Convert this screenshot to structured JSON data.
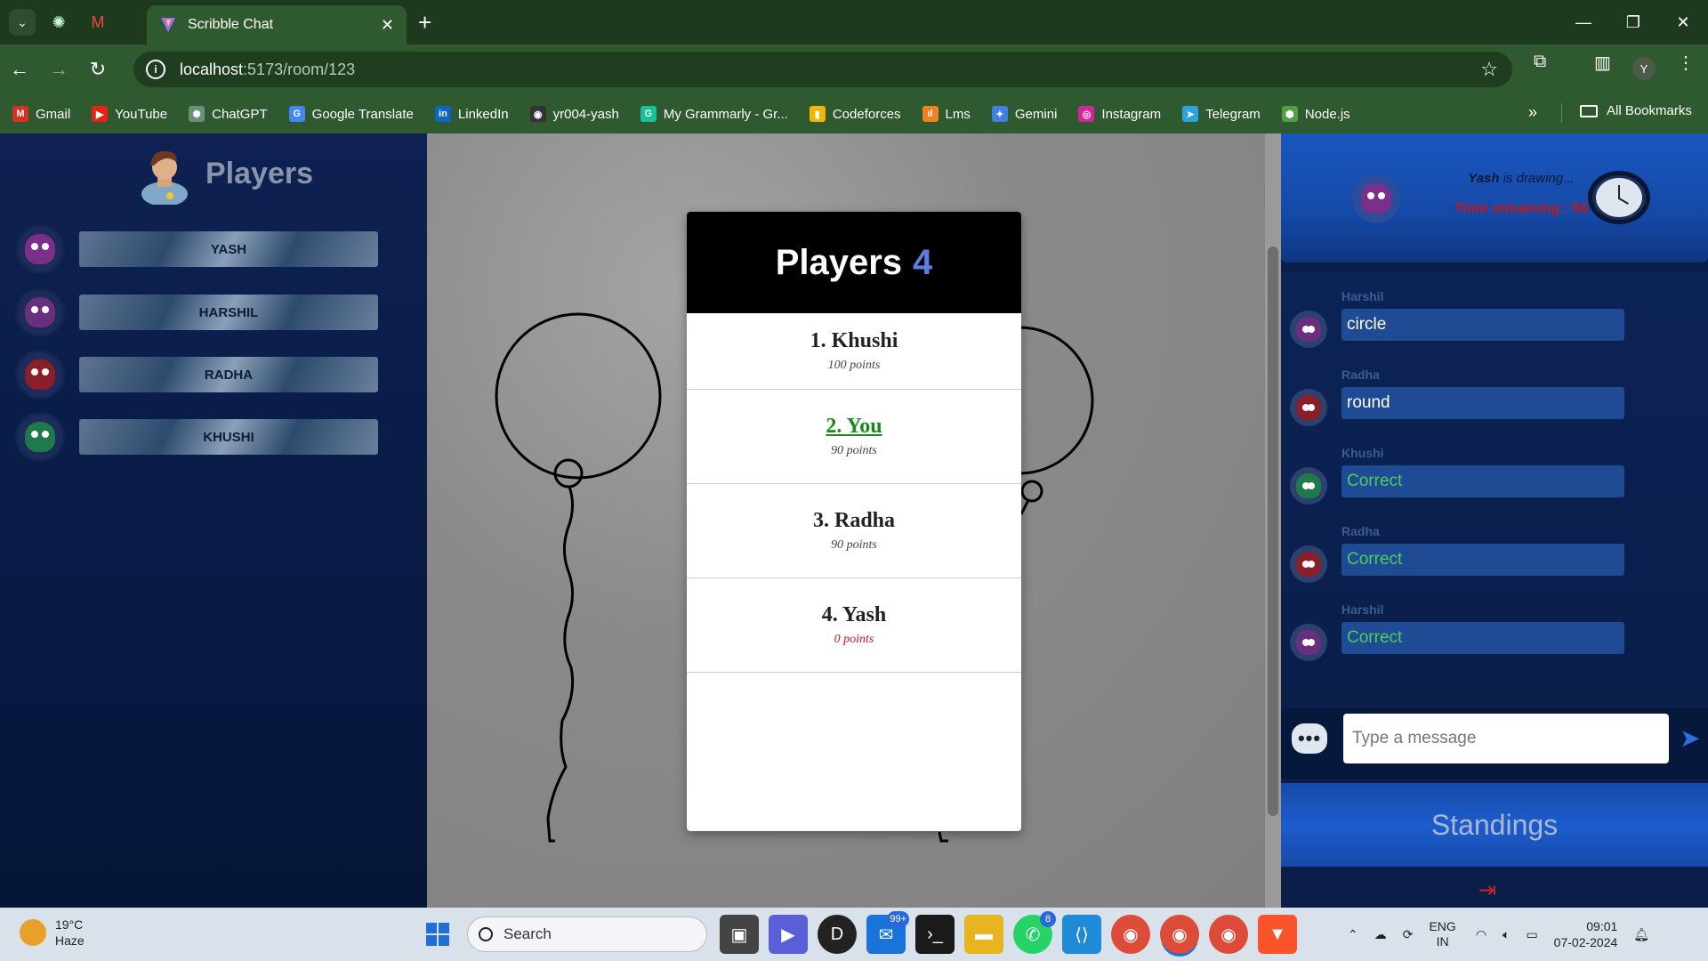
{
  "browser": {
    "tab_title": "Scribble Chat",
    "url_host": "localhost",
    "url_path": ":5173/room/123",
    "profile_initial": "Y",
    "bookmarks": [
      {
        "label": "Gmail",
        "color": "#d93025",
        "glyph": "M"
      },
      {
        "label": "YouTube",
        "color": "#e62117",
        "glyph": "▶"
      },
      {
        "label": "ChatGPT",
        "color": "#6b8f7b",
        "glyph": "✺"
      },
      {
        "label": "Google Translate",
        "color": "#4285f4",
        "glyph": "G"
      },
      {
        "label": "LinkedIn",
        "color": "#0a66c2",
        "glyph": "in"
      },
      {
        "label": "yr004-yash",
        "color": "#333",
        "glyph": "◉"
      },
      {
        "label": "My Grammarly - Gr...",
        "color": "#15c39a",
        "glyph": "G"
      },
      {
        "label": "Codeforces",
        "color": "#f4b400",
        "glyph": "▮"
      },
      {
        "label": "Lms",
        "color": "#f08020",
        "glyph": "ıl"
      },
      {
        "label": "Gemini",
        "color": "#3e7fe8",
        "glyph": "✦"
      },
      {
        "label": "Instagram",
        "color": "#d6249f",
        "glyph": "◎"
      },
      {
        "label": "Telegram",
        "color": "#2aa3e0",
        "glyph": "➤"
      },
      {
        "label": "Node.js",
        "color": "#539e43",
        "glyph": "⬢"
      }
    ],
    "all_bookmarks": "All Bookmarks"
  },
  "left": {
    "title": "Players",
    "players": [
      {
        "name": "YASH",
        "color": "#7a2f8a"
      },
      {
        "name": "HARSHIL",
        "color": "#6a2e7e"
      },
      {
        "name": "RADHA",
        "color": "#8a1f2a"
      },
      {
        "name": "KHUSHI",
        "color": "#1e7a4a"
      }
    ]
  },
  "modal": {
    "title": "Players",
    "count": "4",
    "rows": [
      {
        "name": "1. Khushi",
        "points": "100 points"
      },
      {
        "name": "2. You",
        "points": "90 points"
      },
      {
        "name": "3. Radha",
        "points": "90 points"
      },
      {
        "name": "4. Yash",
        "points": "0 points"
      }
    ]
  },
  "right": {
    "drawer_name": "Yash",
    "drawer_suffix": " is drawing...",
    "time_remaining": "Time remaining : 56",
    "messages": [
      {
        "sender": "Harshil",
        "text": "circle",
        "correct": false,
        "color": "#6a2e7e"
      },
      {
        "sender": "Radha",
        "text": "round",
        "correct": false,
        "color": "#8a1f2a"
      },
      {
        "sender": "Khushi",
        "text": "Correct",
        "correct": true,
        "color": "#1e7a4a"
      },
      {
        "sender": "Radha",
        "text": "Correct",
        "correct": true,
        "color": "#8a1f2a"
      },
      {
        "sender": "Harshil",
        "text": "Correct",
        "correct": true,
        "color": "#6a2e7e"
      }
    ],
    "input_placeholder": "Type a message",
    "standings_label": "Standings"
  },
  "taskbar": {
    "temp": "19°C",
    "weather": "Haze",
    "search_label": "Search",
    "mail_badge": "99+",
    "whatsapp_badge": "8",
    "lang_top": "ENG",
    "lang_bottom": "IN",
    "time": "09:01",
    "date": "07-02-2024"
  }
}
